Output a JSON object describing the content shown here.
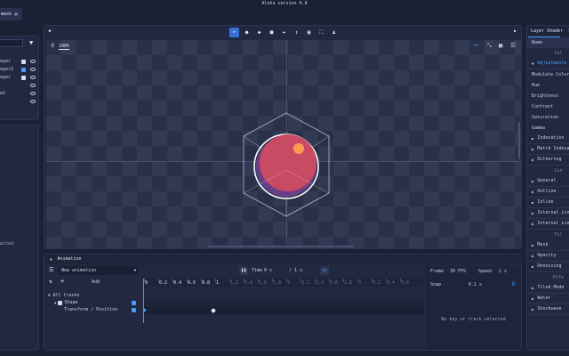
{
  "window": {
    "title": "Aloha version 0.8",
    "tab_label": "mask"
  },
  "layers": {
    "items": [
      {
        "label": "ayer"
      },
      {
        "label": "ayer2"
      },
      {
        "label": "ayer"
      },
      {
        "label": ""
      },
      {
        "label": "e2"
      }
    ],
    "footer_text": "ected"
  },
  "viewport": {
    "zoom_label": "100%",
    "toolbar_icons": [
      "cursor-icon",
      "brush-icon",
      "fill-icon",
      "square-icon",
      "pen-icon",
      "expand-icon",
      "transform-icon",
      "frame-icon",
      "stamp-icon"
    ]
  },
  "right_panel": {
    "tabs": [
      "Layer Shader",
      "S"
    ],
    "name_label": "Name",
    "sections": [
      {
        "type": "header",
        "label": "Col"
      },
      {
        "type": "section",
        "label": "Adjustments",
        "open": true,
        "accent": true
      },
      {
        "type": "prop",
        "label": "Modulate Color"
      },
      {
        "type": "prop",
        "label": "Hue"
      },
      {
        "type": "prop",
        "label": "Brightness"
      },
      {
        "type": "prop",
        "label": "Contrast"
      },
      {
        "type": "prop",
        "label": "Saturation"
      },
      {
        "type": "prop",
        "label": "Gamma"
      },
      {
        "type": "section",
        "label": "Indexation"
      },
      {
        "type": "section",
        "label": "Match Indexatio"
      },
      {
        "type": "section",
        "label": "Dithering"
      },
      {
        "type": "header",
        "label": "Lin"
      },
      {
        "type": "section",
        "label": "General"
      },
      {
        "type": "section",
        "label": "Outline"
      },
      {
        "type": "section",
        "label": "Inline"
      },
      {
        "type": "section",
        "label": "Internal Line F"
      },
      {
        "type": "section",
        "label": "Internal Line F"
      },
      {
        "type": "header",
        "label": "Fil"
      },
      {
        "type": "section",
        "label": "Mask"
      },
      {
        "type": "section",
        "label": "Opacity"
      },
      {
        "type": "section",
        "label": "Denoising"
      },
      {
        "type": "header",
        "label": "Effe"
      },
      {
        "type": "section",
        "label": "Tiled Mode"
      },
      {
        "type": "section",
        "label": "Water"
      },
      {
        "type": "section",
        "label": "Shockwave"
      }
    ]
  },
  "animation": {
    "title": "Animation",
    "animation_select": "New animation",
    "add_label": "Add",
    "time_label": "Time",
    "time_value": "0 s",
    "time_total": "/ 1 s",
    "ruler_labels": [
      "0",
      "0.2",
      "0.4",
      "0.6",
      "0.8",
      "1",
      "1.2",
      "1.4",
      "1.6",
      "1.8",
      "2",
      "2.2",
      "2.4",
      "2.6",
      "2.8",
      "3",
      "3.2",
      "3.4",
      "3.6"
    ],
    "tracks_header": "All tracks",
    "track_group": "Shape",
    "track_item": "Transform / Position",
    "fps_label": "Frame",
    "fps_value": "30 FPS",
    "speed_label": "Speed",
    "speed_value": "1 x",
    "snap_label": "Snap",
    "snap_value": "0.1 s",
    "empty_text": "No key or track selected"
  },
  "colors": {
    "accent": "#4d9bff",
    "ball": "#c94a63",
    "ball_shadow": "#6a3f8a",
    "highlight": "#ff9a52"
  }
}
